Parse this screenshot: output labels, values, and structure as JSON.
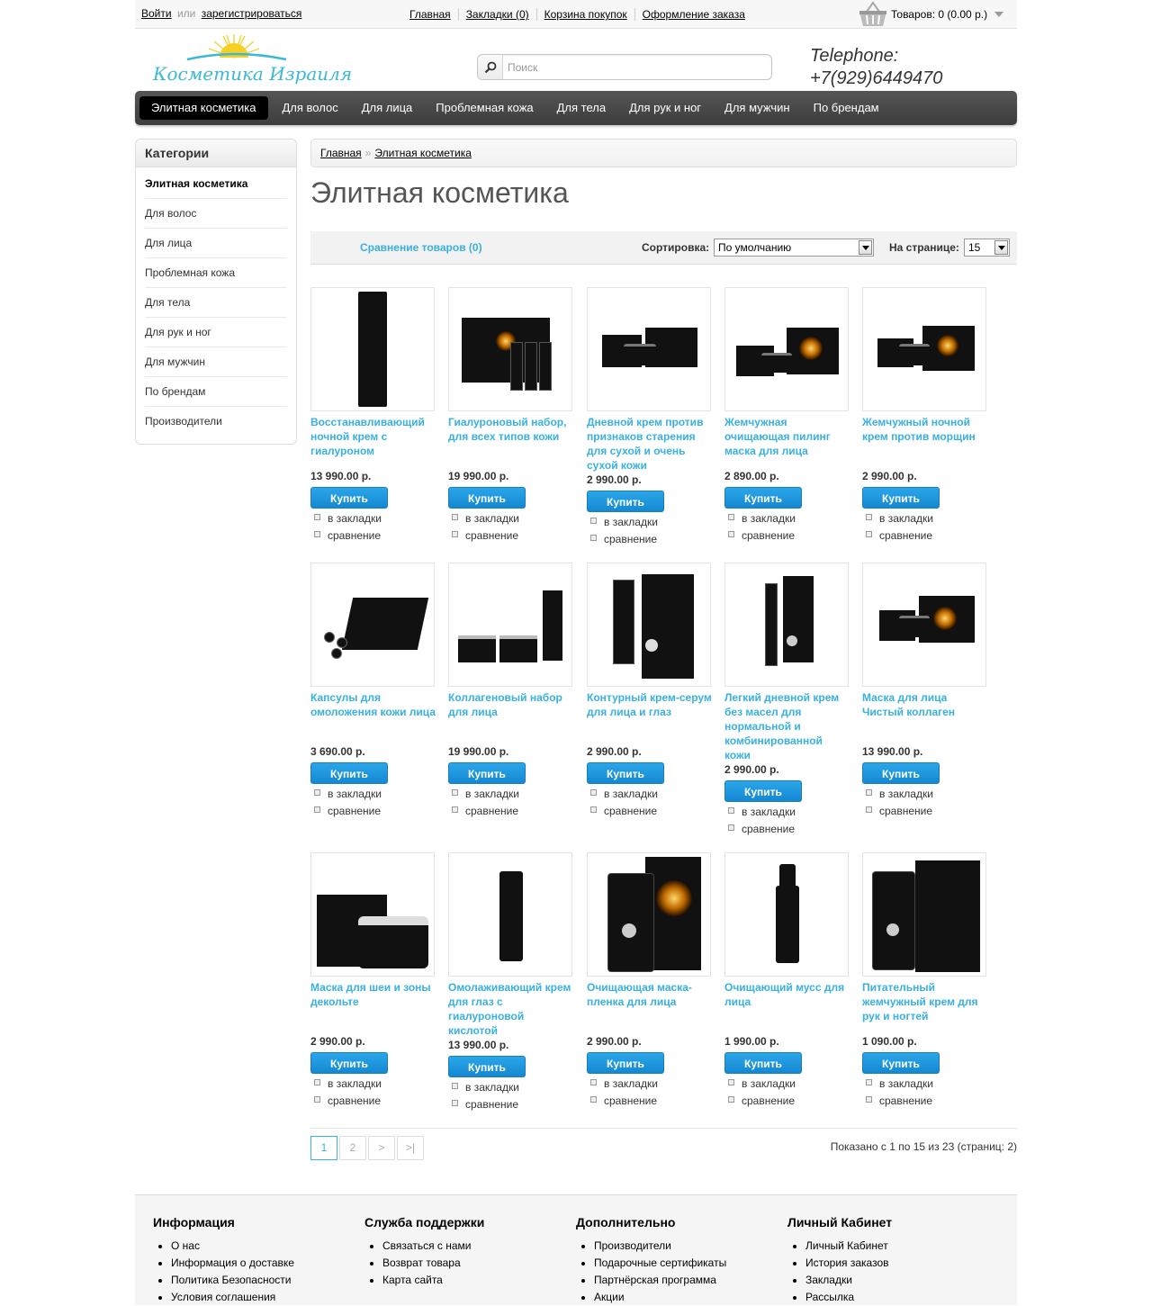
{
  "topbar": {
    "login": "Войти",
    "or": "или",
    "register": "зарегистрироваться",
    "links": [
      "Главная",
      "Закладки (0)",
      "Корзина покупок",
      "Оформление заказа"
    ],
    "cart": "Товаров: 0 (0.00 р.)"
  },
  "header": {
    "logo_text": "Косметика Израиля",
    "search_placeholder": "Поиск",
    "phone_label": "Telephone:",
    "phone": "+7(929)6449470"
  },
  "menu": [
    "Элитная косметика",
    "Для волос",
    "Для лица",
    "Проблемная кожа",
    "Для тела",
    "Для рук и ног",
    "Для мужчин",
    "По брендам"
  ],
  "sidebar": {
    "title": "Категории",
    "items": [
      "Элитная косметика",
      "Для волос",
      "Для лица",
      "Проблемная кожа",
      "Для тела",
      "Для рук и ног",
      "Для мужчин",
      "По брендам",
      "Производители"
    ]
  },
  "breadcrumb": [
    "Главная",
    "Элитная косметика"
  ],
  "page_title": "Элитная косметика",
  "filters": {
    "compare": "Сравнение товаров (0)",
    "sort_label": "Сортировка:",
    "sort_value": "По умолчанию",
    "limit_label": "На странице:",
    "limit_value": "15"
  },
  "labels": {
    "buy": "Купить",
    "wishlist": "в закладки",
    "compare": "сравнение"
  },
  "products": [
    {
      "name": "Восстанавливающий ночной крем с гиалуроном",
      "price": "13 990.00 р."
    },
    {
      "name": "Гиалуроновый набор, для всех типов кожи",
      "price": "19 990.00 р."
    },
    {
      "name": "Дневной крем против признаков старения для сухой и очень сухой кожи",
      "price": "2 990.00 р."
    },
    {
      "name": "Жемчужная очищающая пилинг маска для лица",
      "price": "2 890.00 р."
    },
    {
      "name": "Жемчужный ночной крем против морщин",
      "price": "2 990.00 р."
    },
    {
      "name": "Капсулы для омоложения кожи лица",
      "price": "3 690.00 р."
    },
    {
      "name": "Коллагеновый набор для лица",
      "price": "19 990.00 р."
    },
    {
      "name": "Контурный крем-серум для лица и глаз",
      "price": "2 990.00 р."
    },
    {
      "name": "Легкий дневной крем без масел для нормальной и комбинированной кожи",
      "price": "2 990.00 р."
    },
    {
      "name": "Маска для лица Чистый коллаген",
      "price": "13 990.00 р."
    },
    {
      "name": "Маска для шеи и зоны декольте",
      "price": "2 990.00 р."
    },
    {
      "name": "Омолаживающий крем для глаз с гиалуроновой кислотой",
      "price": "13 990.00 р."
    },
    {
      "name": "Очищающая маска-пленка для лица",
      "price": "2 990.00 р."
    },
    {
      "name": "Очищающий мусс для лица",
      "price": "1 990.00 р."
    },
    {
      "name": "Питательный жемчужный крем для рук и ногтей",
      "price": "1 090.00 р."
    }
  ],
  "pagination": {
    "pages": [
      "1",
      "2",
      ">",
      ">|"
    ],
    "info": "Показано с 1 по 15 из 23 (страниц: 2)"
  },
  "footer": [
    {
      "title": "Информация",
      "items": [
        "О нас",
        "Информация о доставке",
        "Политика Безопасности",
        "Условия соглашения"
      ]
    },
    {
      "title": "Служба поддержки",
      "items": [
        "Связаться с нами",
        "Возврат товара",
        "Карта сайта"
      ]
    },
    {
      "title": "Дополнительно",
      "items": [
        "Производители",
        "Подарочные сертификаты",
        "Партнёрская программа",
        "Акции"
      ]
    },
    {
      "title": "Личный Кабинет",
      "items": [
        "Личный Кабинет",
        "История заказов",
        "Закладки",
        "Рассылка"
      ]
    }
  ],
  "colors": {
    "accent": "#38b0e3",
    "menu_bg": "#4a4a4a",
    "buy_button": "#1a93dc"
  }
}
